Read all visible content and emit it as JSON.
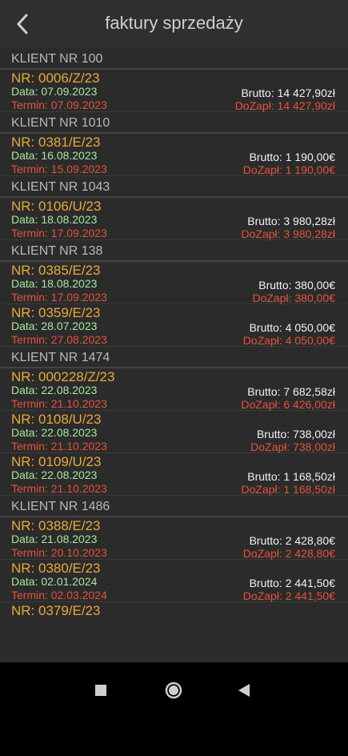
{
  "header": {
    "title": "faktury sprzedaży"
  },
  "groups": [
    {
      "client": "KLIENT NR 100",
      "invoices": [
        {
          "nr": "NR: 0006/Z/23",
          "data": "Data: 07.09.2023",
          "termin": "Termin: 07.09.2023",
          "brutto": "Brutto: 14 427,90zł",
          "dozap": "DoZapł: 14 427,90zł"
        }
      ]
    },
    {
      "client": "KLIENT NR 1010",
      "invoices": [
        {
          "nr": "NR: 0381/E/23",
          "data": "Data: 16.08.2023",
          "termin": "Termin: 15.09.2023",
          "brutto": "Brutto: 1 190,00€",
          "dozap": "DoZapł: 1 190,00€"
        }
      ]
    },
    {
      "client": "KLIENT NR 1043",
      "invoices": [
        {
          "nr": "NR: 0106/U/23",
          "data": "Data: 18.08.2023",
          "termin": "Termin: 17.09.2023",
          "brutto": "Brutto: 3 980,28zł",
          "dozap": "DoZapł: 3 980,28zł"
        }
      ]
    },
    {
      "client": "KLIENT NR 138",
      "invoices": [
        {
          "nr": "NR: 0385/E/23",
          "data": "Data: 18.08.2023",
          "termin": "Termin: 17.09.2023",
          "brutto": "Brutto: 380,00€",
          "dozap": "DoZapł: 380,00€"
        },
        {
          "nr": "NR: 0359/E/23",
          "data": "Data: 28.07.2023",
          "termin": "Termin: 27.08.2023",
          "brutto": "Brutto: 4 050,00€",
          "dozap": "DoZapł: 4 050,00€"
        }
      ]
    },
    {
      "client": "KLIENT NR 1474",
      "invoices": [
        {
          "nr": "NR: 000228/Z/23",
          "data": "Data: 22.08.2023",
          "termin": "Termin: 21.10.2023",
          "brutto": "Brutto: 7 682,58zł",
          "dozap": "DoZapł: 6 426,00zł"
        },
        {
          "nr": "NR: 0108/U/23",
          "data": "Data: 22.08.2023",
          "termin": "Termin: 21.10.2023",
          "brutto": "Brutto: 738,00zł",
          "dozap": "DoZapł: 738,00zł"
        },
        {
          "nr": "NR: 0109/U/23",
          "data": "Data: 22.08.2023",
          "termin": "Termin: 21.10.2023",
          "brutto": "Brutto: 1 168,50zł",
          "dozap": "DoZapł: 1 168,50zł"
        }
      ]
    },
    {
      "client": "KLIENT NR 1486",
      "invoices": [
        {
          "nr": "NR: 0388/E/23",
          "data": "Data: 21.08.2023",
          "termin": "Termin: 20.10.2023",
          "brutto": "Brutto: 2 428,80€",
          "dozap": "DoZapł: 2 428,80€"
        },
        {
          "nr": "NR: 0380/E/23",
          "data": "Data: 02.01.2024",
          "termin": "Termin: 02.03.2024",
          "brutto": "Brutto: 2 441,50€",
          "dozap": "DoZapł: 2 441,50€"
        },
        {
          "nr": "NR: 0379/E/23",
          "data": "",
          "termin": "",
          "brutto": "",
          "dozap": ""
        }
      ]
    }
  ],
  "navbar": {
    "icons": [
      "recent-apps-icon",
      "home-icon",
      "back-icon"
    ]
  }
}
